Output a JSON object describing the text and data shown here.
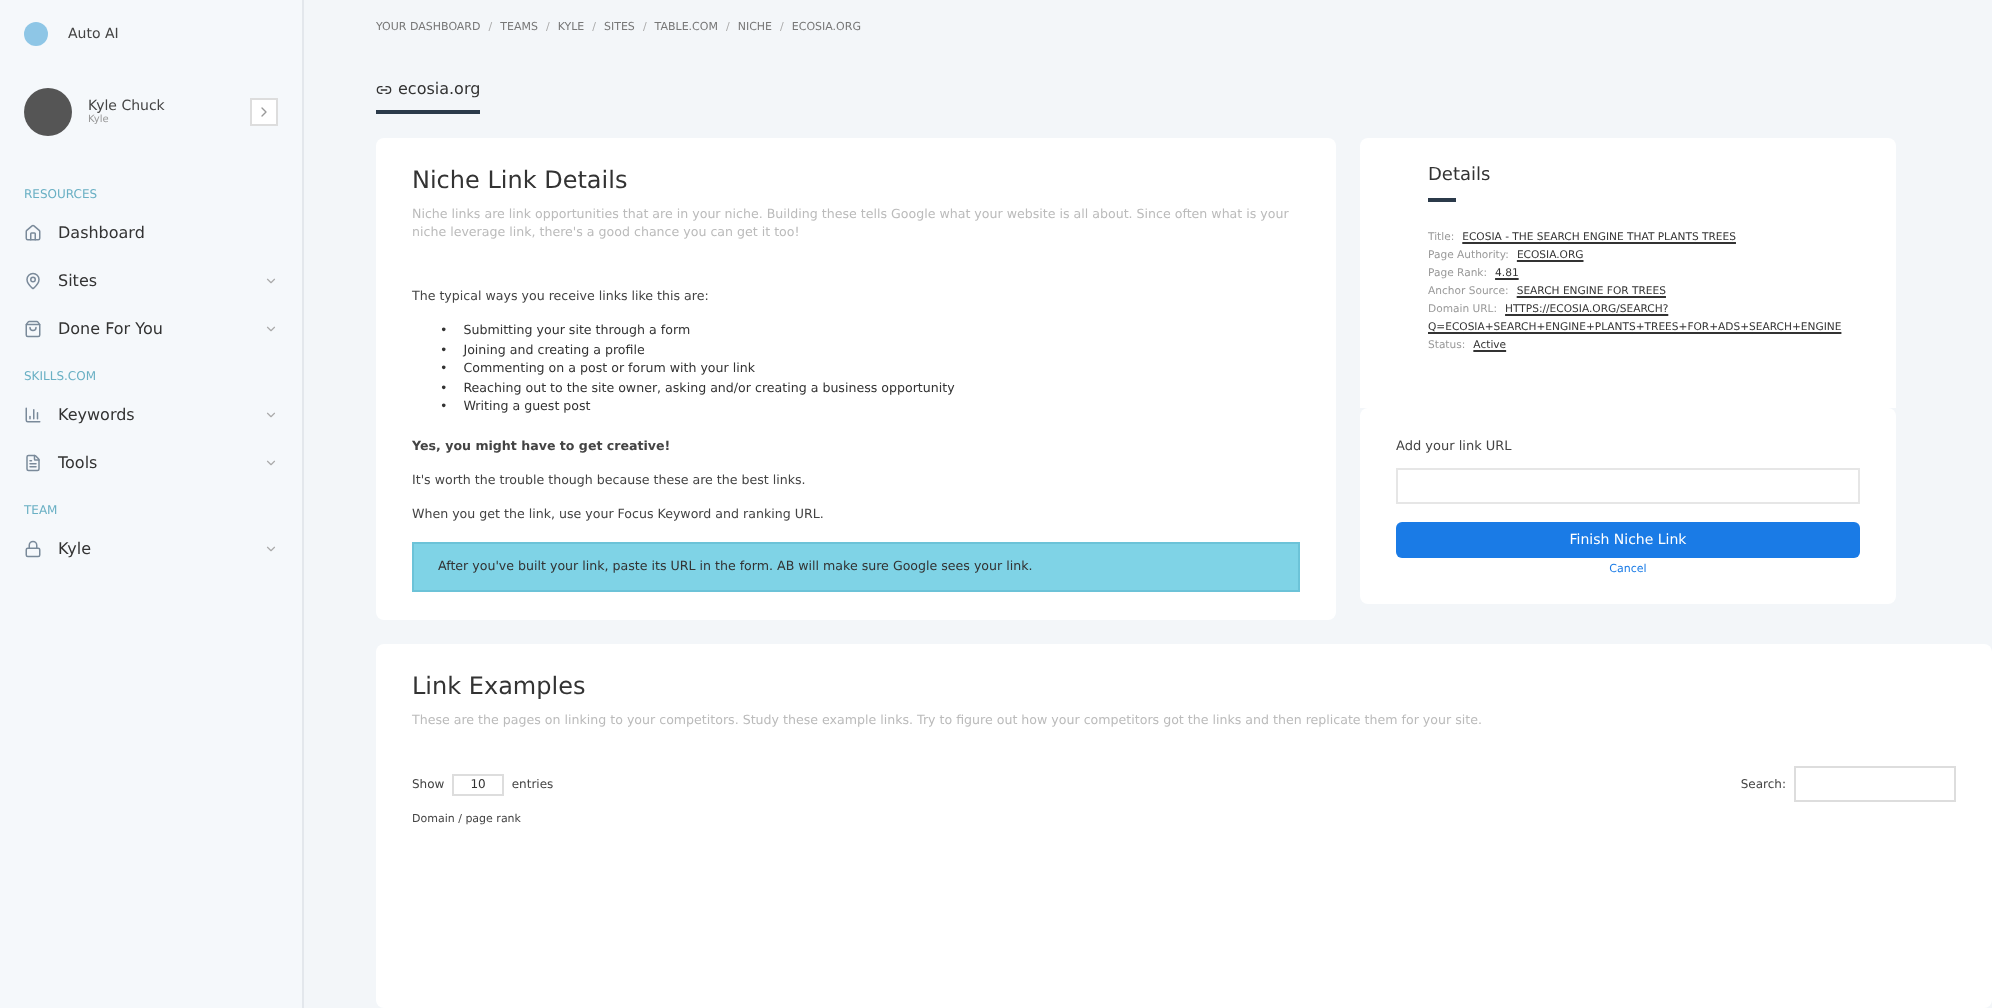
{
  "app": {
    "name": "Auto AI"
  },
  "breadcrumb_separator": "/",
  "breadcrumb": [
    "YOUR DASHBOARD",
    "TEAMS",
    "KYLE",
    "SITES",
    "TABLE.COM",
    "NICHE",
    "ECOSIA.ORG"
  ],
  "user": {
    "name": "Kyle Chuck",
    "role": "Kyle"
  },
  "sidebar": {
    "sections": [
      {
        "title": "RESOURCES",
        "items": [
          {
            "label": "Dashboard",
            "kind": "home",
            "expandable": false
          },
          {
            "label": "Sites",
            "kind": "pin",
            "expandable": true
          },
          {
            "label": "Done For You",
            "kind": "bag",
            "expandable": true
          }
        ]
      },
      {
        "title": "SKILLS.COM",
        "items": [
          {
            "label": "Keywords",
            "kind": "chart",
            "expandable": true
          },
          {
            "label": "Tools",
            "kind": "doc",
            "expandable": true
          }
        ]
      },
      {
        "title": "TEAM",
        "items": [
          {
            "label": "Kyle",
            "kind": "lock",
            "expandable": true
          }
        ]
      }
    ]
  },
  "page_tab": {
    "label": "ecosia.org"
  },
  "niche": {
    "title": "Niche Link Details",
    "intro": "Niche links are link opportunities that are in your niche. Building these tells Google what your website is all about. Since often what is your niche leverage link, there's a good chance you can get it too!",
    "lead": "The typical ways you receive links like this are:",
    "bullet_mark": "•",
    "bullets": [
      "Submitting your site through a form",
      "Joining and creating a profile",
      "Commenting on a post or forum with your link",
      "Reaching out to the site owner, asking and/or creating a business opportunity",
      "Writing a guest post"
    ],
    "paragraphs": [
      "Yes, you might have to get creative!",
      "It's worth the trouble though because these are the best links.",
      "When you get the link, use your Focus Keyword and ranking URL."
    ],
    "callout": "After you've built your link, paste its URL in the form. AB will make sure Google sees your link."
  },
  "details": {
    "title": "Details",
    "rows": [
      {
        "label": "Title:",
        "value": "ECOSIA - THE SEARCH ENGINE THAT PLANTS TREES"
      },
      {
        "label": "Page Authority:",
        "value": "ECOSIA.ORG"
      },
      {
        "label": "Page Rank:",
        "value": "4.81"
      },
      {
        "label": "Anchor Source:",
        "value": "SEARCH ENGINE FOR TREES"
      },
      {
        "label": "Domain URL:",
        "value": "HTTPS://ECOSIA.ORG/SEARCH?Q=ECOSIA+SEARCH+ENGINE+PLANTS+TREES+FOR+ADS+SEARCH+ENGINE"
      },
      {
        "label": "Status:",
        "value": "Active"
      }
    ],
    "url_label": "Add your link URL",
    "submit": "Finish Niche Link",
    "cancel": "Cancel"
  },
  "examples": {
    "title": "Link Examples",
    "intro": "These are the pages on linking to your competitors. Study these example links. Try to figure out how your competitors got the links and then replicate them for your site.",
    "show": "Show",
    "entries_value": "10",
    "entries": "entries",
    "search": "Search:",
    "column_1": "Domain / page rank"
  }
}
